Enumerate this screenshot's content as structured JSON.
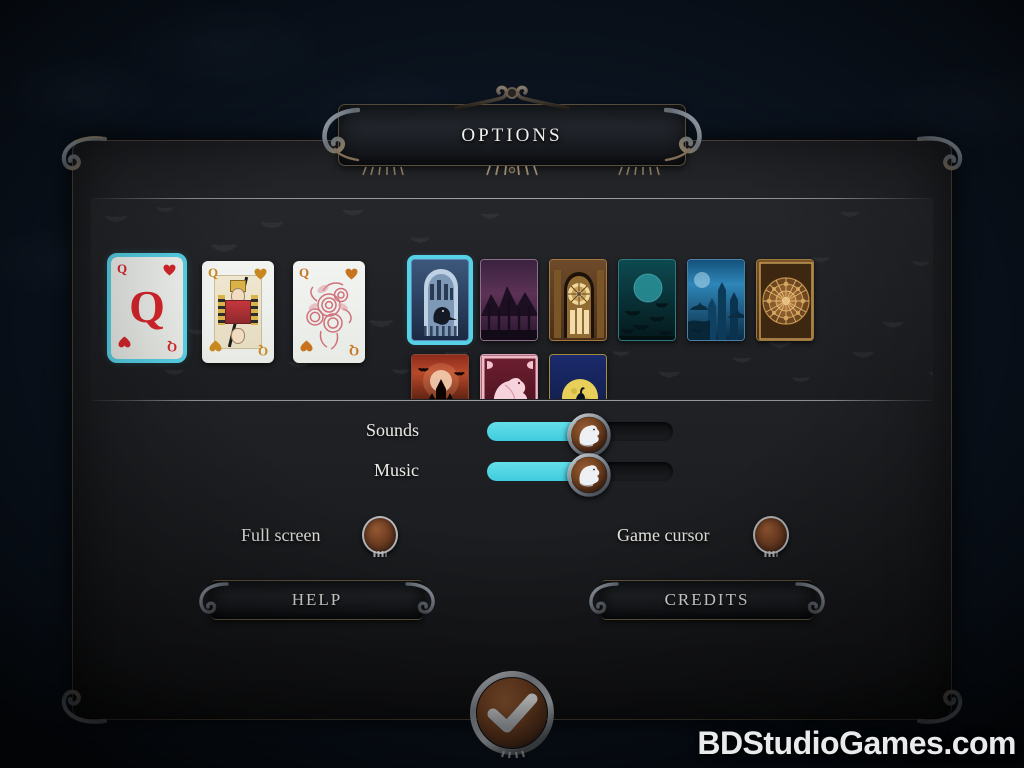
{
  "window": {
    "title": "OPTIONS"
  },
  "theme": {
    "accent": "#56d2e8",
    "panel_bg": "#212327",
    "backdrop": "#1d3248",
    "text": "#eceae6",
    "brass": "#6a5540",
    "knob_brown": "#7a4426"
  },
  "card_faces": {
    "section_name": "card-face-style",
    "selected_index": 0,
    "items": [
      {
        "id": "face-plain-q",
        "name": "Plain Q of Hearts",
        "rank": "Q",
        "suit": "hearts",
        "suit_glyph": "♥",
        "selected": true
      },
      {
        "id": "face-classic-queen",
        "name": "Classic Queen of Hearts",
        "rank": "Q",
        "suit": "hearts",
        "suit_glyph": "♥",
        "selected": false
      },
      {
        "id": "face-roses-queen",
        "name": "Roses Queen of Hearts",
        "rank": "Q",
        "suit": "hearts",
        "suit_glyph": "♥",
        "selected": false
      }
    ]
  },
  "card_backs": {
    "section_name": "card-back-style",
    "selected_index": 0,
    "items": [
      {
        "id": "back-raven-arch",
        "name": "Raven in blue archway",
        "selected": true,
        "row": 1
      },
      {
        "id": "back-purple-forest",
        "name": "Purple forest mountains",
        "selected": false,
        "row": 1
      },
      {
        "id": "back-rose-window-gold",
        "name": "Golden gothic rose window",
        "selected": false,
        "row": 1
      },
      {
        "id": "back-teal-moon-bats",
        "name": "Teal moon with bats",
        "selected": false,
        "row": 1
      },
      {
        "id": "back-blue-castle-night",
        "name": "Blue castle at night",
        "selected": false,
        "row": 1
      },
      {
        "id": "back-copper-mandala",
        "name": "Copper stained-glass mandala",
        "selected": false,
        "row": 1
      },
      {
        "id": "back-red-castle-moon",
        "name": "Red moonlit castle",
        "selected": false,
        "row": 2
      },
      {
        "id": "back-pink-raven",
        "name": "Pink raven on crimson",
        "selected": false,
        "row": 2
      },
      {
        "id": "back-yellow-moon-raven",
        "name": "Raven on branch, yellow moon",
        "selected": false,
        "row": 2
      }
    ]
  },
  "sliders": [
    {
      "id": "sounds",
      "label": "Sounds",
      "value": 55,
      "min": 0,
      "max": 100
    },
    {
      "id": "music",
      "label": "Music",
      "value": 55,
      "min": 0,
      "max": 100
    }
  ],
  "toggles": [
    {
      "id": "full-screen",
      "label": "Full screen",
      "enabled": false
    },
    {
      "id": "game-cursor",
      "label": "Game cursor",
      "enabled": false
    }
  ],
  "buttons": {
    "help": {
      "label": "HELP"
    },
    "credits": {
      "label": "CREDITS"
    },
    "ok": {
      "label": "",
      "icon": "check-icon"
    }
  },
  "watermark": {
    "text": "BDStudioGames.com"
  }
}
